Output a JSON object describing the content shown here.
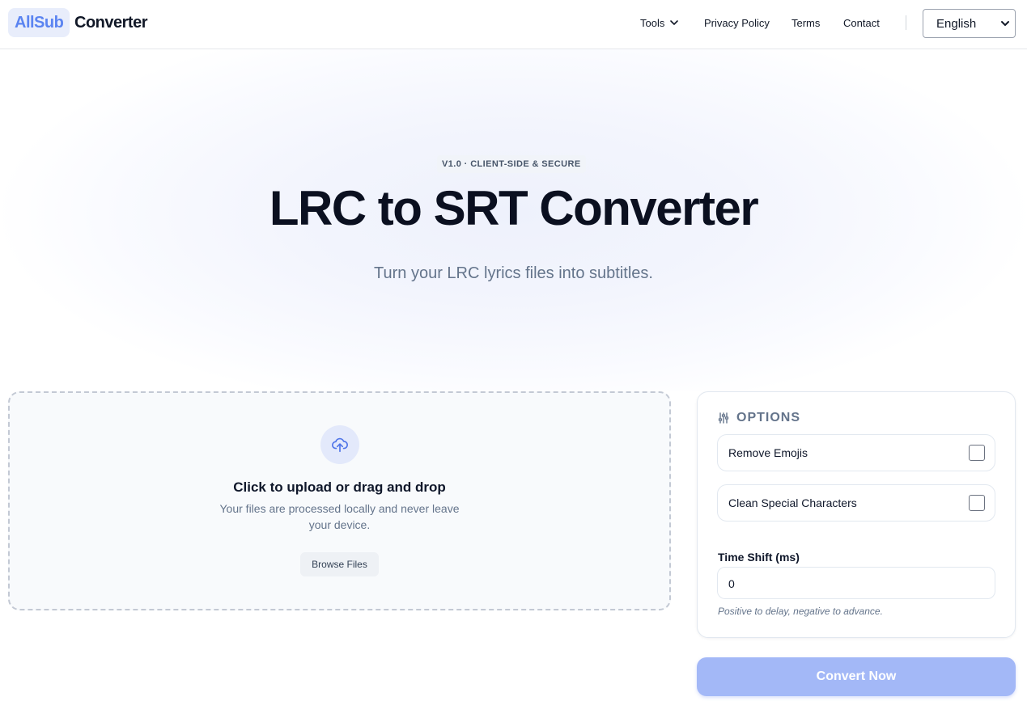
{
  "header": {
    "logo_badge": "AllSub",
    "logo_text": "Converter",
    "nav": {
      "tools": "Tools",
      "privacy": "Privacy Policy",
      "terms": "Terms",
      "contact": "Contact"
    },
    "language_selected": "English"
  },
  "hero": {
    "badge": "V1.0 · CLIENT-SIDE & SECURE",
    "title": "LRC to SRT Converter",
    "subtitle": "Turn your LRC lyrics files into subtitles."
  },
  "upload": {
    "icon": "cloud-upload-icon",
    "title": "Click to upload or drag and drop",
    "description": "Your files are processed locally and never leave your device.",
    "browse_label": "Browse Files"
  },
  "options": {
    "heading": "OPTIONS",
    "icon": "sliders-icon",
    "remove_emojis": {
      "label": "Remove Emojis",
      "checked": false
    },
    "clean_special": {
      "label": "Clean Special Characters",
      "checked": false
    },
    "time_shift": {
      "label": "Time Shift (ms)",
      "value": "0",
      "hint": "Positive to delay, negative to advance."
    }
  },
  "convert_label": "Convert Now",
  "colors": {
    "brand_blue": "#5b84f1",
    "convert_disabled": "#a3b8f7"
  }
}
